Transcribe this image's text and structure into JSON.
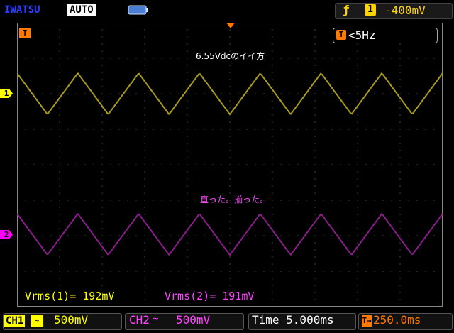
{
  "header": {
    "brand": "IWATSU",
    "acquisition_mode": "AUTO",
    "battery_icon": "battery-icon",
    "trigger": {
      "edge_icon": "rising-edge-icon",
      "edge_glyph": "ƒ",
      "source": "1",
      "level": "-400mV",
      "color": "#ffd400"
    }
  },
  "screen": {
    "trigger_position_label": "T",
    "frequency_icon": "T",
    "frequency": "<5Hz",
    "annotation_ch1": "6.55Vdcのイイ方",
    "annotation_ch2": "直った。揃った。"
  },
  "channels": {
    "ch1": {
      "marker": "1",
      "color": "#ffff00",
      "trace_color": "#a89b1c",
      "measurement": "Vrms(1)= 192mV",
      "label": "CH1",
      "coupling": "~",
      "scale": "500mV"
    },
    "ch2": {
      "marker": "2",
      "color": "#ff44ff",
      "trace_color": "#8a1e8a",
      "measurement": "Vrms(2)= 191mV",
      "label": "CH2",
      "coupling": "~",
      "scale": "500mV"
    }
  },
  "timebase": {
    "label": "Time 5.000ms",
    "delay_icon": "T→",
    "delay": "250.0ms",
    "delay_color": "#ff7a00"
  },
  "waveforms": {
    "ch1": {
      "shape": "triangle",
      "cycles": 7,
      "phase_deg": 0
    },
    "ch2": {
      "shape": "triangle",
      "cycles": 7,
      "phase_deg": 0
    }
  }
}
